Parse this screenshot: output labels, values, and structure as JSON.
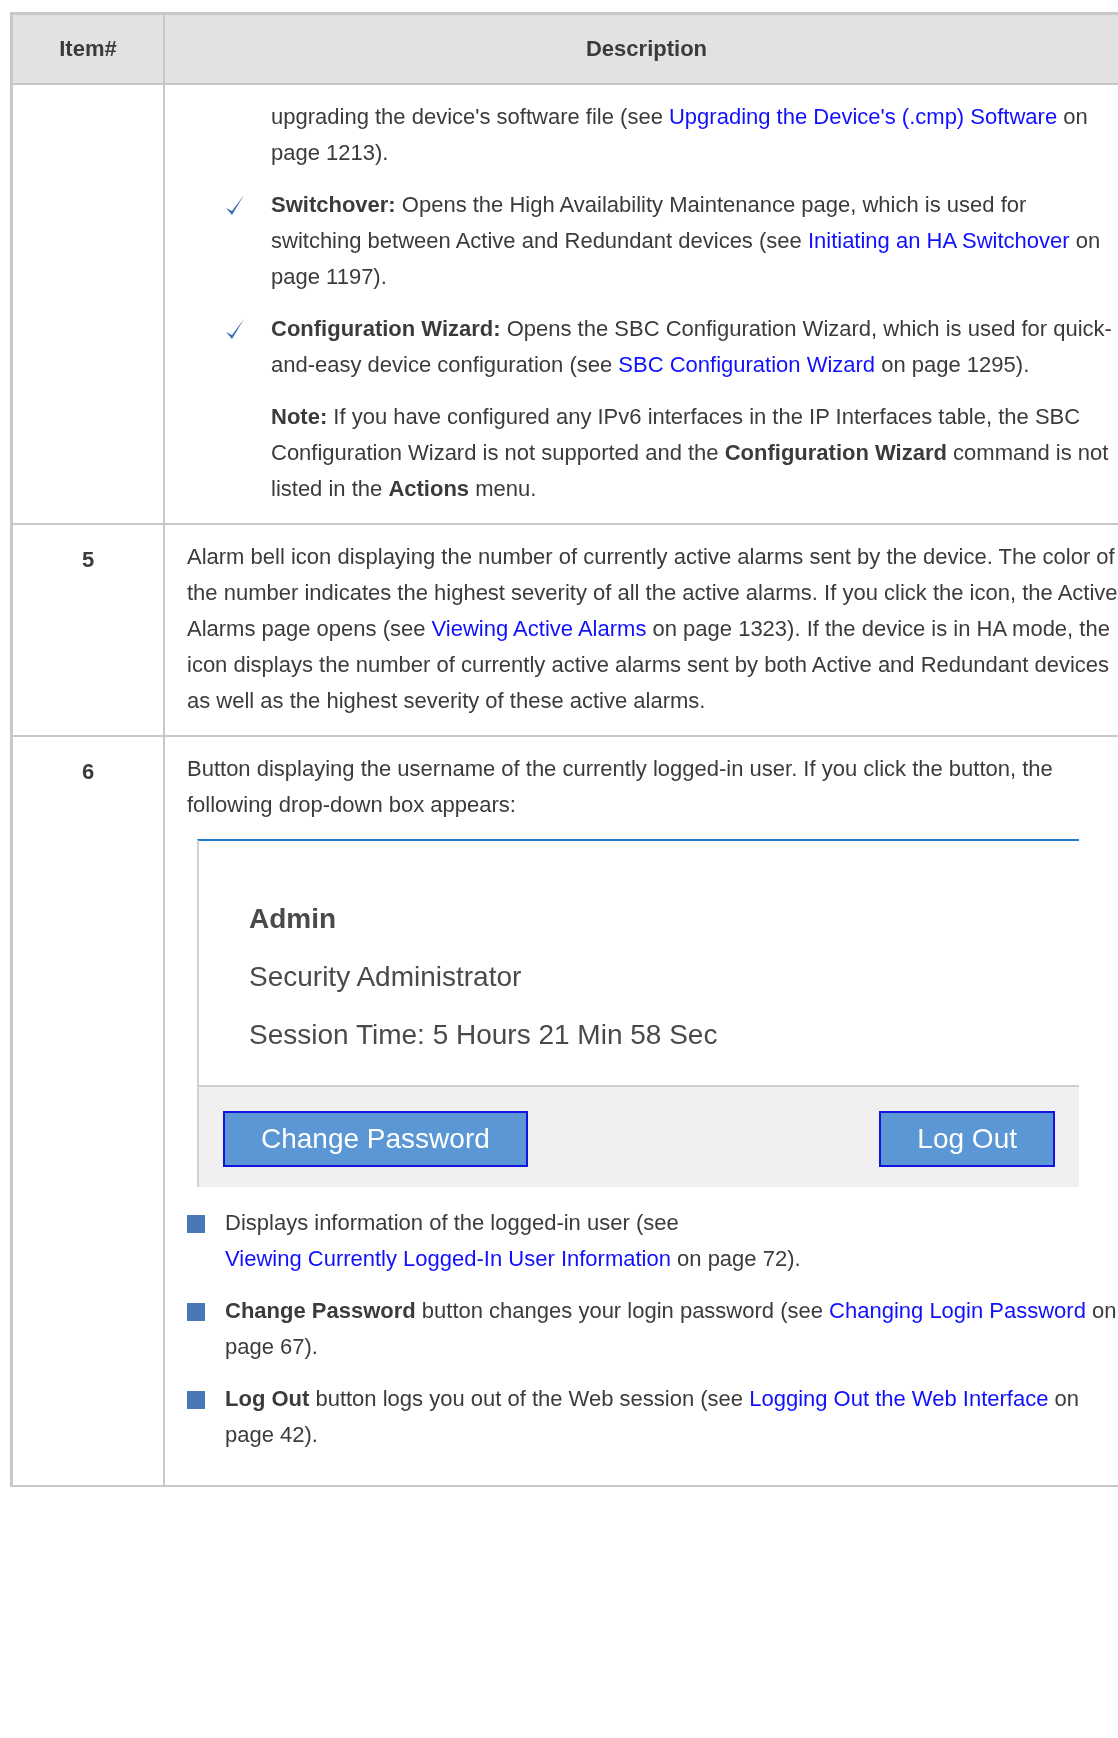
{
  "table": {
    "columns": [
      "Item#",
      "Description"
    ],
    "rows": [
      {
        "blocks": [
          {
            "kind": "indented",
            "segments": [
              {
                "kind": "text",
                "text": "upgrading the device's software file (see "
              },
              {
                "kind": "link",
                "text": "Upgrading the Device's (.cmp) Software"
              },
              {
                "kind": "text",
                "text": " on page 1213)."
              }
            ]
          },
          {
            "kind": "check",
            "segments": [
              {
                "kind": "bold",
                "text": "Switchover:"
              },
              {
                "kind": "text",
                "text": " Opens the High Availability Maintenance page, which is used for switching between Active and Redundant devices (see "
              },
              {
                "kind": "link",
                "text": "Initiating an HA Switchover"
              },
              {
                "kind": "text",
                "text": " on page 1197)."
              }
            ]
          },
          {
            "kind": "check",
            "segments": [
              {
                "kind": "bold",
                "text": "Configuration Wizard:"
              },
              {
                "kind": "text",
                "text": " Opens the SBC Configuration Wizard, which is used for quick-and-easy device configuration (see "
              },
              {
                "kind": "link",
                "text": "SBC Configuration Wizard"
              },
              {
                "kind": "text",
                "text": " on page 1295)."
              }
            ]
          },
          {
            "kind": "indented",
            "segments": [
              {
                "kind": "bold",
                "text": "Note:"
              },
              {
                "kind": "text",
                "text": " If you have configured any IPv6 interfaces in the IP Interfaces table, the SBC Configuration Wizard is not supported and the "
              },
              {
                "kind": "bold",
                "text": "Configuration Wizard"
              },
              {
                "kind": "text",
                "text": " command is not listed in the "
              },
              {
                "kind": "bold",
                "text": "Actions"
              },
              {
                "kind": "text",
                "text": " menu."
              }
            ]
          }
        ]
      },
      {
        "item": "5",
        "blocks": [
          {
            "kind": "text",
            "segments": [
              {
                "kind": "text",
                "text": "Alarm bell icon displaying the number of currently active alarms sent by the device. The color of the number indicates the highest severity of all the active alarms. If you click the icon, the Active Alarms page opens (see "
              },
              {
                "kind": "link",
                "text": "Viewing Active Alarms"
              },
              {
                "kind": "text",
                "text": " on page 1323). If the device is in HA mode, the icon displays the number of currently active alarms sent by both Active and Redundant devices as well as the highest severity of these active alarms."
              }
            ]
          }
        ]
      },
      {
        "item": "6",
        "blocks": [
          {
            "kind": "text",
            "segments": [
              {
                "kind": "text",
                "text": "Button displaying the username of the currently logged-in user. If you click the button, the following drop-down box appears:"
              }
            ]
          },
          {
            "kind": "dropdown",
            "user": "Admin",
            "role": "Security Administrator",
            "session": "Session Time: 5 Hours 21 Min 58 Sec",
            "buttons": [
              "Change Password",
              "Log Out"
            ]
          },
          {
            "kind": "square",
            "segments": [
              {
                "kind": "text",
                "text": "Displays information of the logged-in user (see "
              },
              {
                "kind": "link",
                "text": "Viewing Currently Logged-In User Information"
              },
              {
                "kind": "text",
                "text": " on page 72)."
              }
            ]
          },
          {
            "kind": "square",
            "segments": [
              {
                "kind": "bold",
                "text": "Change Password"
              },
              {
                "kind": "text",
                "text": " button changes your login password (see "
              },
              {
                "kind": "link",
                "text": "Changing Login Password"
              },
              {
                "kind": "text",
                "text": " on page 67)."
              }
            ]
          },
          {
            "kind": "square",
            "segments": [
              {
                "kind": "bold",
                "text": "Log Out"
              },
              {
                "kind": "text",
                "text": " button logs you out of the Web session (see "
              },
              {
                "kind": "link",
                "text": "Logging Out the Web Interface"
              },
              {
                "kind": "text",
                "text": " on page 42)."
              }
            ]
          }
        ]
      }
    ]
  }
}
